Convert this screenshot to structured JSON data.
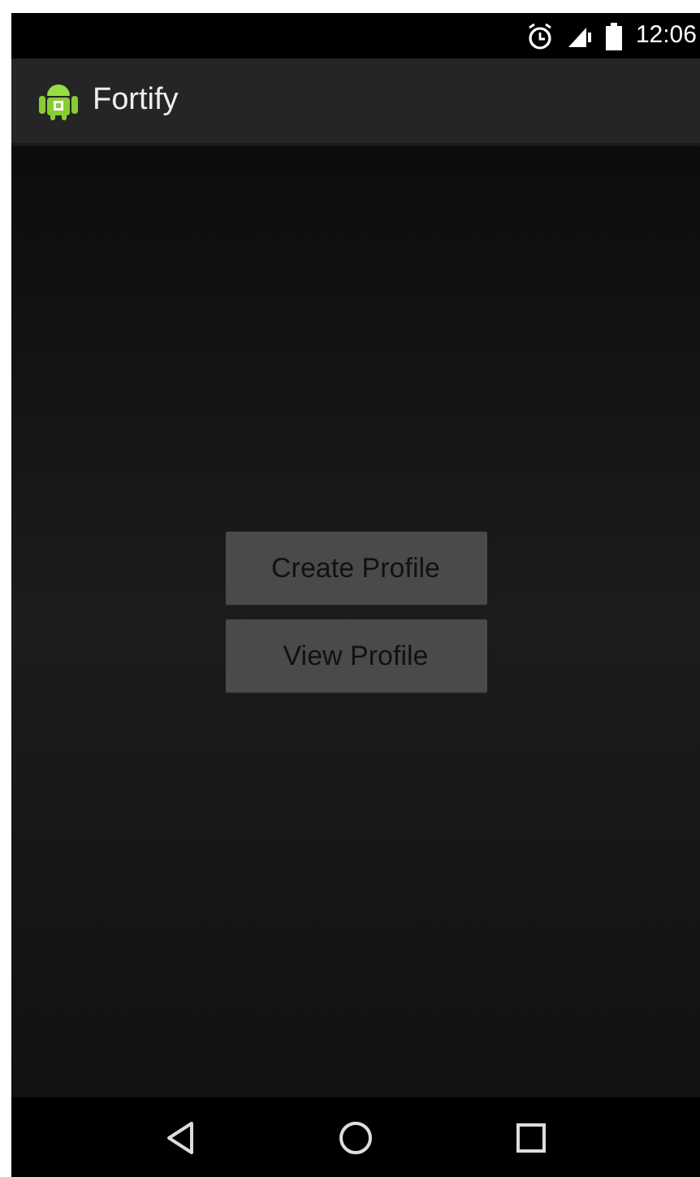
{
  "status_bar": {
    "time": "12:06"
  },
  "action_bar": {
    "title": "Fortify"
  },
  "buttons": [
    {
      "label": "Create Profile"
    },
    {
      "label": "View Profile"
    }
  ]
}
